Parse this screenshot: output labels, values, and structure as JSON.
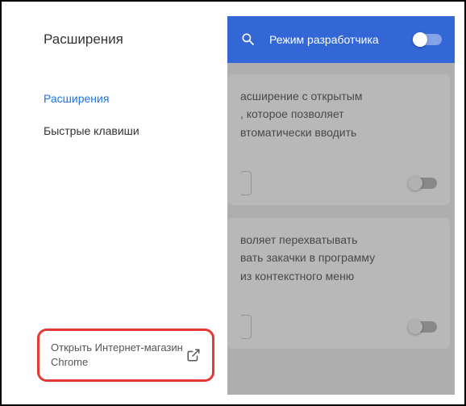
{
  "header": {
    "title": "Расширения",
    "dev_mode_label": "Режим разработчика"
  },
  "sidebar": {
    "items": [
      {
        "label": "Расширения"
      },
      {
        "label": "Быстрые клавиши"
      }
    ],
    "chrome_store_label": "Открыть Интернет-магазин Chrome"
  },
  "cards": [
    {
      "text_lines": [
        "асширение с открытым",
        ", которое позволяет",
        "втоматически вводить"
      ]
    },
    {
      "text_lines": [
        "воляет перехватывать",
        "вать закачки в программу",
        "из контекстного меню"
      ]
    }
  ]
}
